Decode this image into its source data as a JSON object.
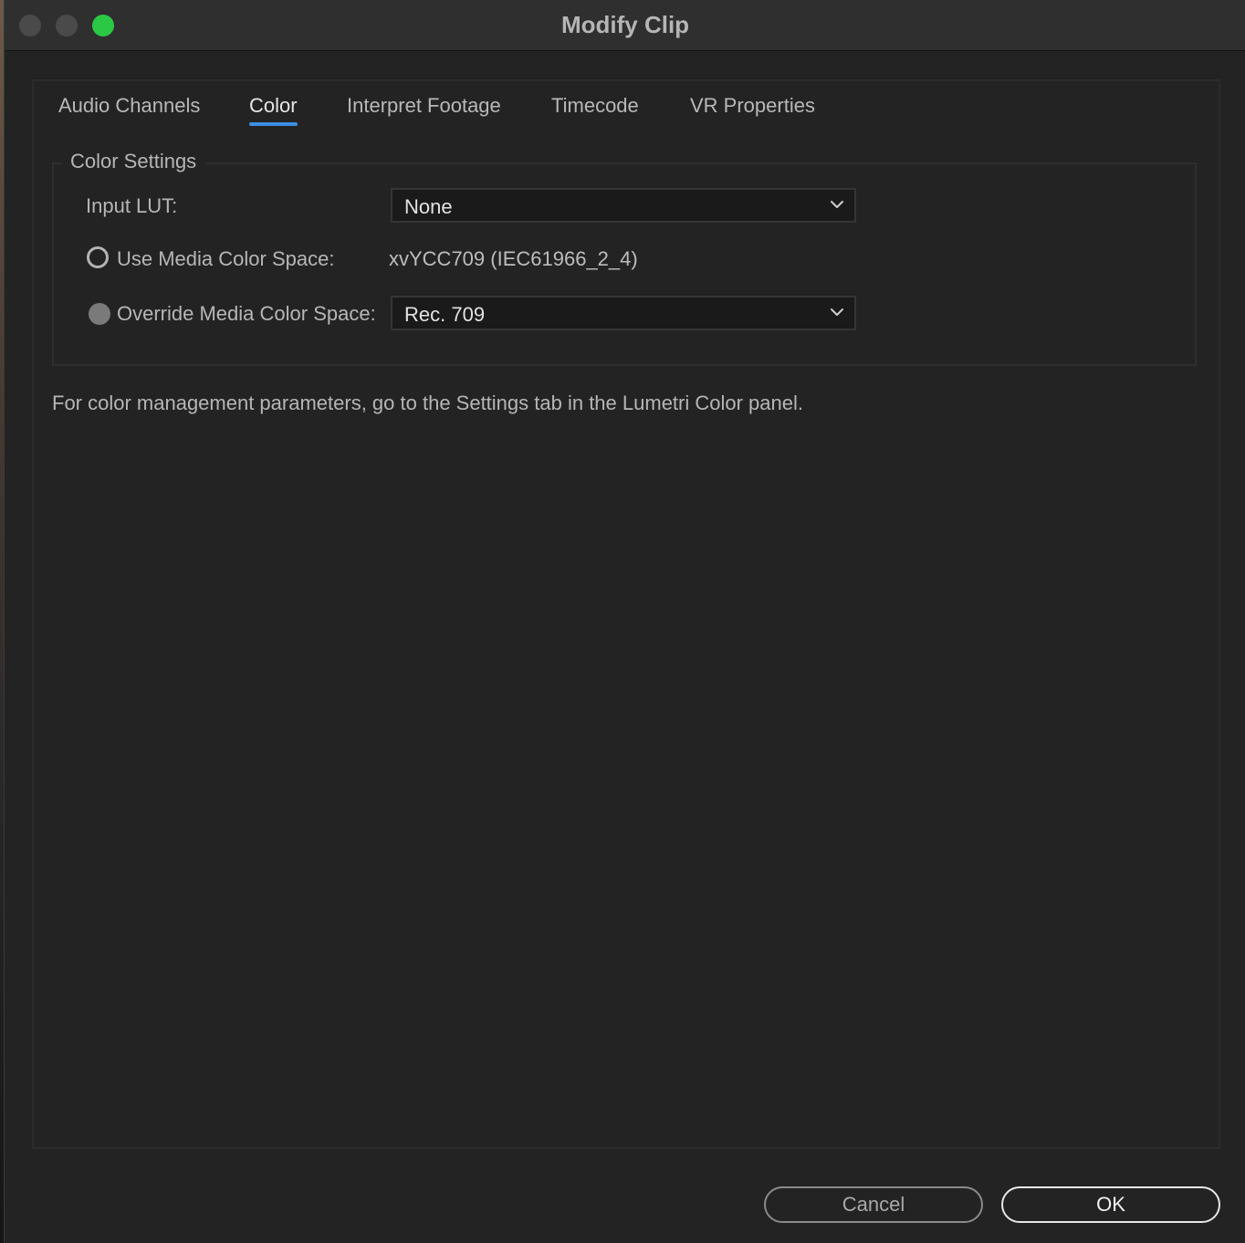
{
  "window": {
    "title": "Modify Clip"
  },
  "tabs": [
    {
      "label": "Audio Channels",
      "active": false
    },
    {
      "label": "Color",
      "active": true
    },
    {
      "label": "Interpret Footage",
      "active": false
    },
    {
      "label": "Timecode",
      "active": false
    },
    {
      "label": "VR Properties",
      "active": false
    }
  ],
  "color_settings": {
    "legend": "Color Settings",
    "input_lut": {
      "label": "Input LUT:",
      "value": "None"
    },
    "use_media": {
      "label": "Use Media Color Space:",
      "value": "xvYCC709 (IEC61966_2_4)",
      "selected": false
    },
    "override_media": {
      "label": "Override Media Color Space:",
      "value": "Rec. 709",
      "selected": false,
      "disabled": true
    }
  },
  "info_text": "For color management parameters, go to the Settings tab in the Lumetri Color panel.",
  "buttons": {
    "cancel": "Cancel",
    "ok": "OK"
  },
  "colors": {
    "accent": "#3d8fe3",
    "window_bg": "#232323",
    "titlebar_bg": "#2f2f2f",
    "zoom_button": "#2ac845"
  },
  "icons": {
    "dropdown": "chevron-down-icon",
    "radio": "radio-button"
  }
}
